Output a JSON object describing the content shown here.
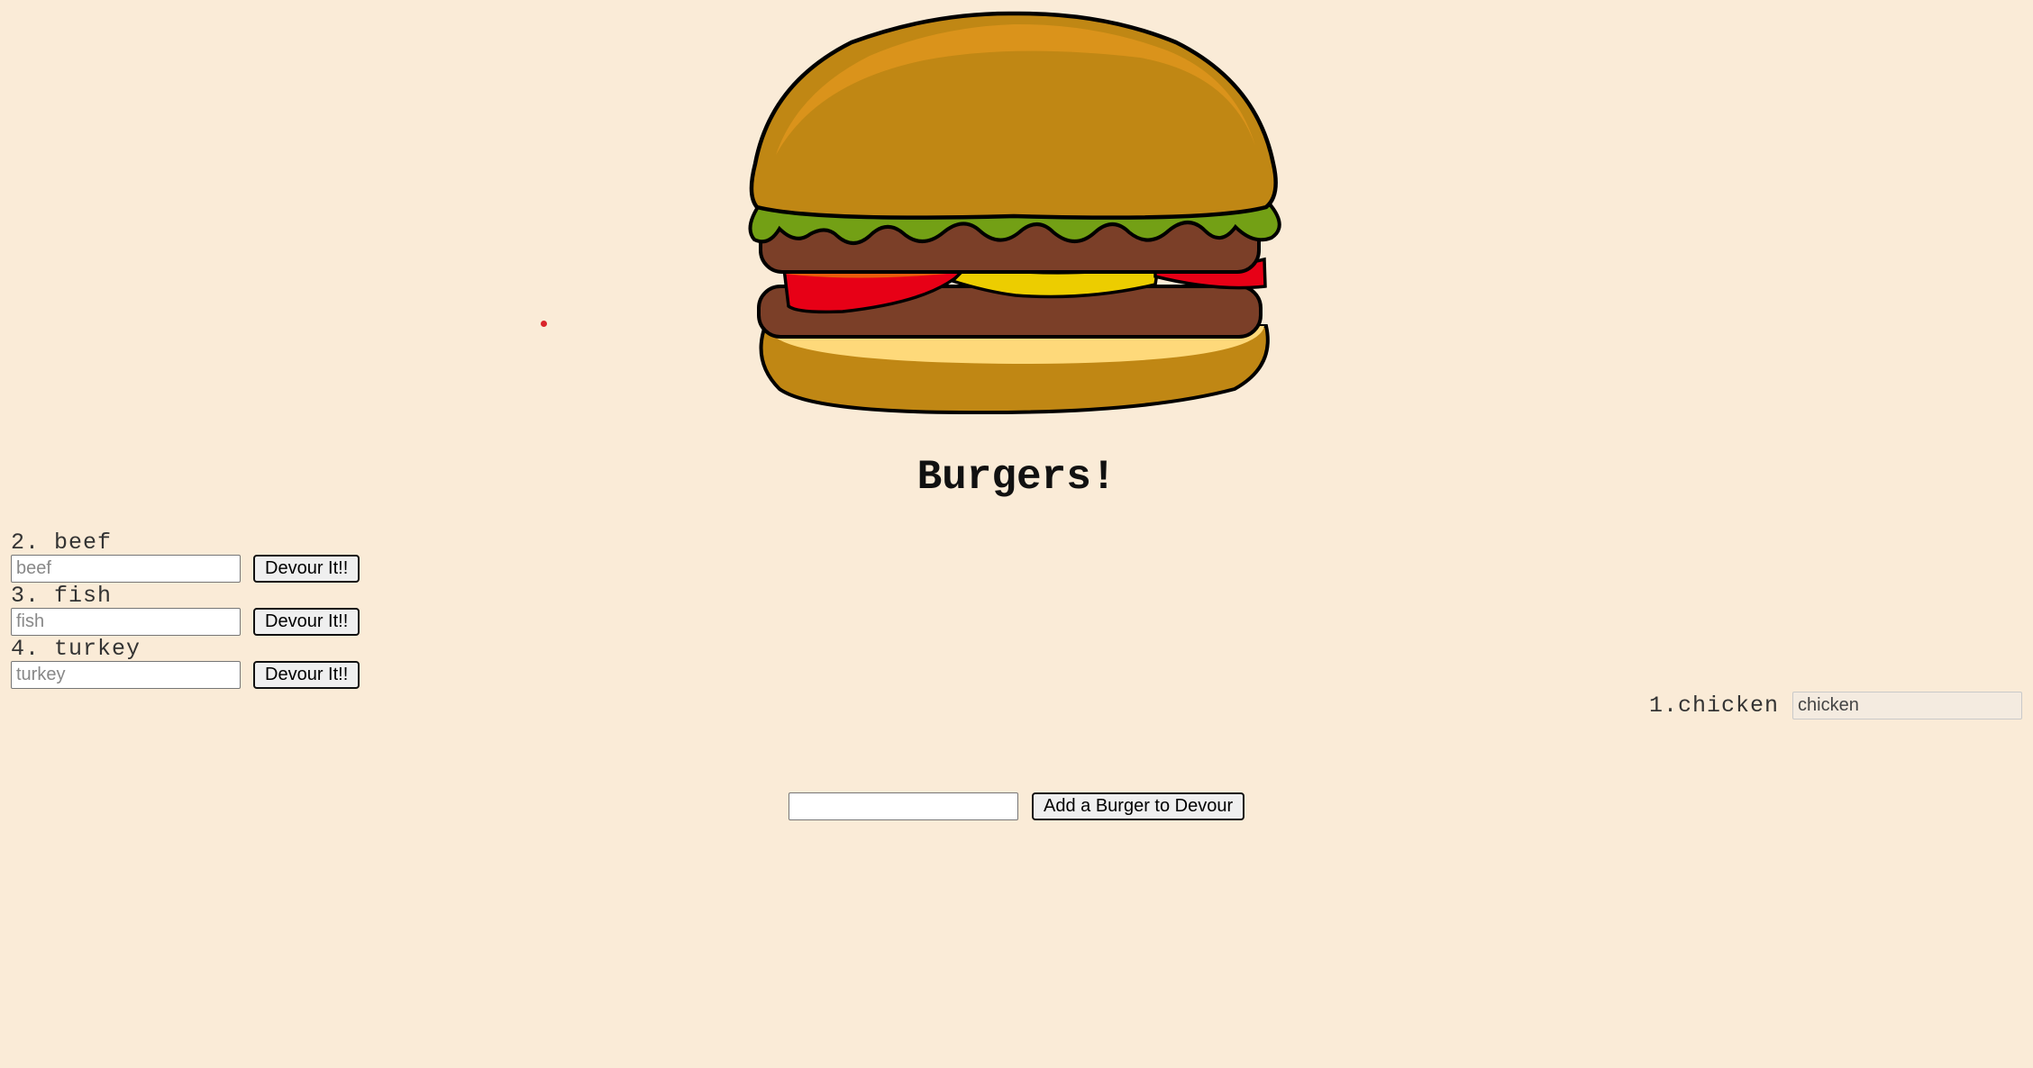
{
  "header": {
    "title": "Burgers!"
  },
  "burgers": [
    {
      "label": "2. beef",
      "placeholder": "beef",
      "button_label": "Devour It!!"
    },
    {
      "label": "3. fish",
      "placeholder": "fish",
      "button_label": "Devour It!!"
    },
    {
      "label": "4. turkey",
      "placeholder": "turkey",
      "button_label": "Devour It!!"
    }
  ],
  "devoured": [
    {
      "label": "1.chicken",
      "value": "chicken"
    }
  ],
  "add_form": {
    "value": "",
    "button_label": "Add a Burger to Devour"
  },
  "icons": {
    "logo": "burger-icon"
  },
  "colors": {
    "background": "#faebd7",
    "bun": "#c08714",
    "bun_top": "#da931b",
    "lettuce": "#73a015",
    "patty": "#7b3f28",
    "tomato": "#e70016",
    "cheese": "#eccd00",
    "bun_inner": "#fed97a"
  }
}
